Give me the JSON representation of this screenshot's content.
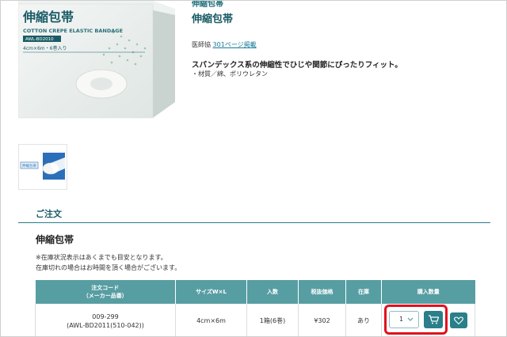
{
  "product": {
    "category_label": "伸縮包帯",
    "title": "伸縮包帯",
    "catalog_prefix": "医師協",
    "catalog_link": "301ページ掲載",
    "headline": "スパンデックス系の伸縮性でひじや関節にぴったりフィット。",
    "material": "・材質／綿、ポリウレタン",
    "box_title": "伸縮包帯",
    "box_subtitle": "COTTON CREPE ELASTIC BANDAGE",
    "box_code": "AWL-BD2010",
    "box_size": "4cm×6m・6巻入り",
    "thumb_label": "伸縮包帯"
  },
  "order": {
    "section_title": "ご注文",
    "product_name": "伸縮包帯",
    "note_1": "※在庫状況表示はあくまでも目安となります。",
    "note_2": "在庫切れの場合はお時間を頂く場合がございます。",
    "columns": {
      "code": "注文コード",
      "code_sub": "（メーカー品番）",
      "size": "サイズW×L",
      "qty": "入数",
      "price": "税抜価格",
      "stock": "在庫",
      "buy": "購入数量"
    },
    "rows": [
      {
        "code": "009-299",
        "maker_code": "(AWL-BD2011(510-042))",
        "size": "4cm×6m",
        "qty": "1箱(6巻)",
        "price": "¥302",
        "stock": "あり",
        "quantity_value": "1"
      }
    ]
  },
  "icons": {
    "cart": "cart-icon",
    "heart": "heart-icon",
    "chevron": "chevron-down-icon"
  },
  "colors": {
    "accent": "#2a7f8a",
    "header_bg": "#579ea3",
    "highlight": "#e0121f"
  }
}
